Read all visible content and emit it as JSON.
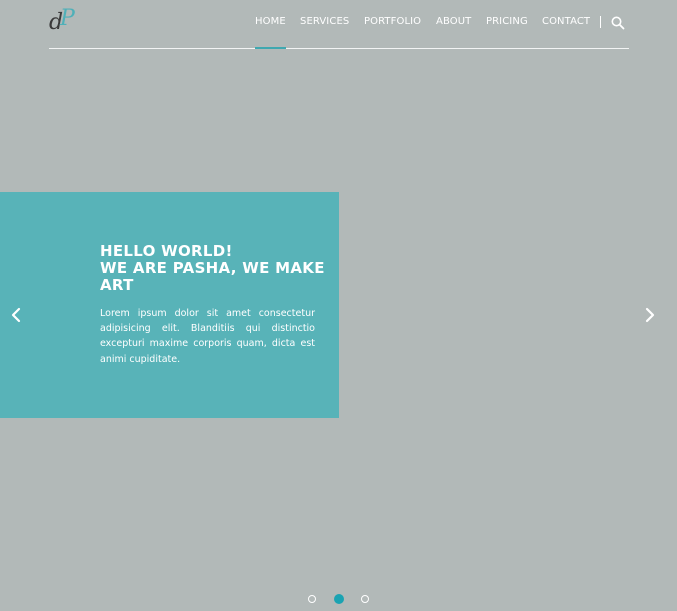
{
  "brand": {
    "logo_letter_1": "d",
    "logo_letter_2": "P",
    "colors": {
      "accent": "#58b3b8",
      "active": "#1aa3b2"
    }
  },
  "nav": {
    "items": [
      {
        "label": "HOME",
        "active": true
      },
      {
        "label": "SERVICES"
      },
      {
        "label": "PORTFOLIO"
      },
      {
        "label": "ABOUT"
      },
      {
        "label": "PRICING"
      },
      {
        "label": "CONTACT"
      }
    ],
    "search_icon": "search-icon"
  },
  "slide": {
    "title_line_1": "HELLO WORLD!",
    "title_line_2": "WE ARE PASHA, WE MAKE",
    "title_line_3": "ART",
    "body": "Lorem ipsum dolor sit amet consectetur adipisicing elit. Blanditiis qui distinctio excepturi maxime corporis quam, dicta est animi cupiditate."
  },
  "carousel": {
    "active_index": 1,
    "count": 3
  }
}
